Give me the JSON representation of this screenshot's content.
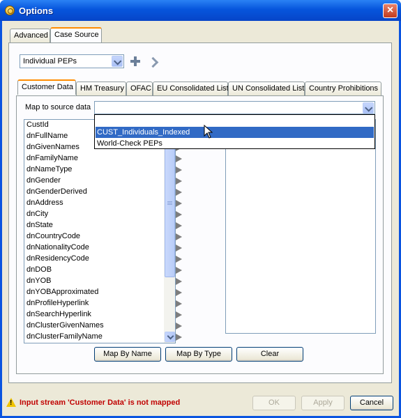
{
  "window": {
    "title": "Options"
  },
  "outer_tabs": [
    {
      "label": "Advanced"
    },
    {
      "label": "Case Source"
    }
  ],
  "source_select": {
    "value": "Individual PEPs"
  },
  "inner_tabs": [
    {
      "label": "Customer Data"
    },
    {
      "label": "HM Treasury"
    },
    {
      "label": "OFAC"
    },
    {
      "label": "EU Consolidated List"
    },
    {
      "label": "UN Consolidated List"
    },
    {
      "label": "Country Prohibitions"
    }
  ],
  "map_to_source": {
    "label": "Map to source data",
    "value": ""
  },
  "dropdown_options": [
    {
      "label": ""
    },
    {
      "label": "CUST_Individuals_Indexed"
    },
    {
      "label": "World-Check PEPs"
    }
  ],
  "fields": [
    "CustId",
    "dnFullName",
    "dnGivenNames",
    "dnFamilyName",
    "dnNameType",
    "dnGender",
    "dnGenderDerived",
    "dnAddress",
    "dnCity",
    "dnState",
    "dnCountryCode",
    "dnNationalityCode",
    "dnResidencyCode",
    "dnDOB",
    "dnYOB",
    "dnYOBApproximated",
    "dnProfileHyperlink",
    "dnSearchHyperlink",
    "dnClusterGivenNames",
    "dnClusterFamilyName"
  ],
  "buttons": {
    "map_by_name": "Map By Name",
    "map_by_type": "Map By Type",
    "clear": "Clear"
  },
  "footer": {
    "status": "Input stream 'Customer Data' is not mapped",
    "ok": "OK",
    "apply": "Apply",
    "cancel": "Cancel"
  }
}
